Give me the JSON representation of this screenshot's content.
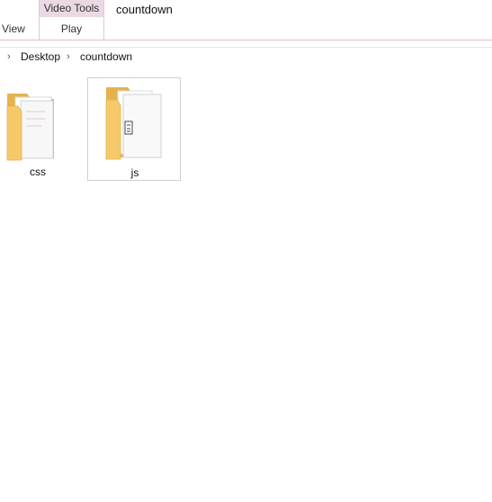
{
  "ribbon": {
    "contextual_group_label": "Video Tools",
    "contextual_tab_label": "Play",
    "view_tab_label": "View",
    "window_title": "countdown"
  },
  "address_bar": {
    "breadcrumbs": [
      "Desktop",
      "countdown"
    ]
  },
  "files": [
    {
      "name": "css",
      "selected": false
    },
    {
      "name": "js",
      "selected": true
    }
  ],
  "colors": {
    "contextual_accent": "#ead9e2",
    "folder_yellow": "#f5c96a",
    "folder_yellow_dark": "#e6b24a",
    "selection_border": "#cfcfcf"
  }
}
